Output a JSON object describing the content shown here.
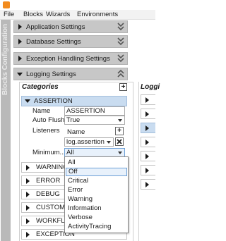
{
  "menu": {
    "file": "File",
    "blocks": "Blocks",
    "wizards": "Wizards",
    "environments": "Environments"
  },
  "sidebar_title": "Blocks Configuration",
  "sections": [
    {
      "label": "Application Settings",
      "expanded": false
    },
    {
      "label": "Database Settings",
      "expanded": false
    },
    {
      "label": "Exception Handling Settings",
      "expanded": false
    },
    {
      "label": "Logging Settings",
      "expanded": true
    }
  ],
  "categories": {
    "title": "Categories",
    "add_symbol": "+",
    "selected": {
      "name": "ASSERTION",
      "fields": {
        "name_label": "Name",
        "name_value": "ASSERTION",
        "auto_flush_label": "Auto Flush",
        "auto_flush_value": "True",
        "listeners_label": "Listeners",
        "listeners_header": "Name",
        "listener_value": "log.assertion",
        "minimum_label": "Minimum...",
        "minimum_value": "All"
      }
    },
    "items": [
      "WARNING",
      "ERROR",
      "DEBUG",
      "CUSTOMIZ",
      "WORKFLOW",
      "EXCEPTION"
    ]
  },
  "level_dropdown": {
    "options": [
      "All",
      "Off",
      "Critical",
      "Error",
      "Warning",
      "Information",
      "Verbose",
      "ActivityTracing"
    ],
    "hovered": "Off"
  },
  "right_panel": {
    "title": "Loggi"
  },
  "colors": {
    "section_bg": "#c7c7c7",
    "selected_bg": "#c9dcf0",
    "accent": "#f28b1e"
  }
}
